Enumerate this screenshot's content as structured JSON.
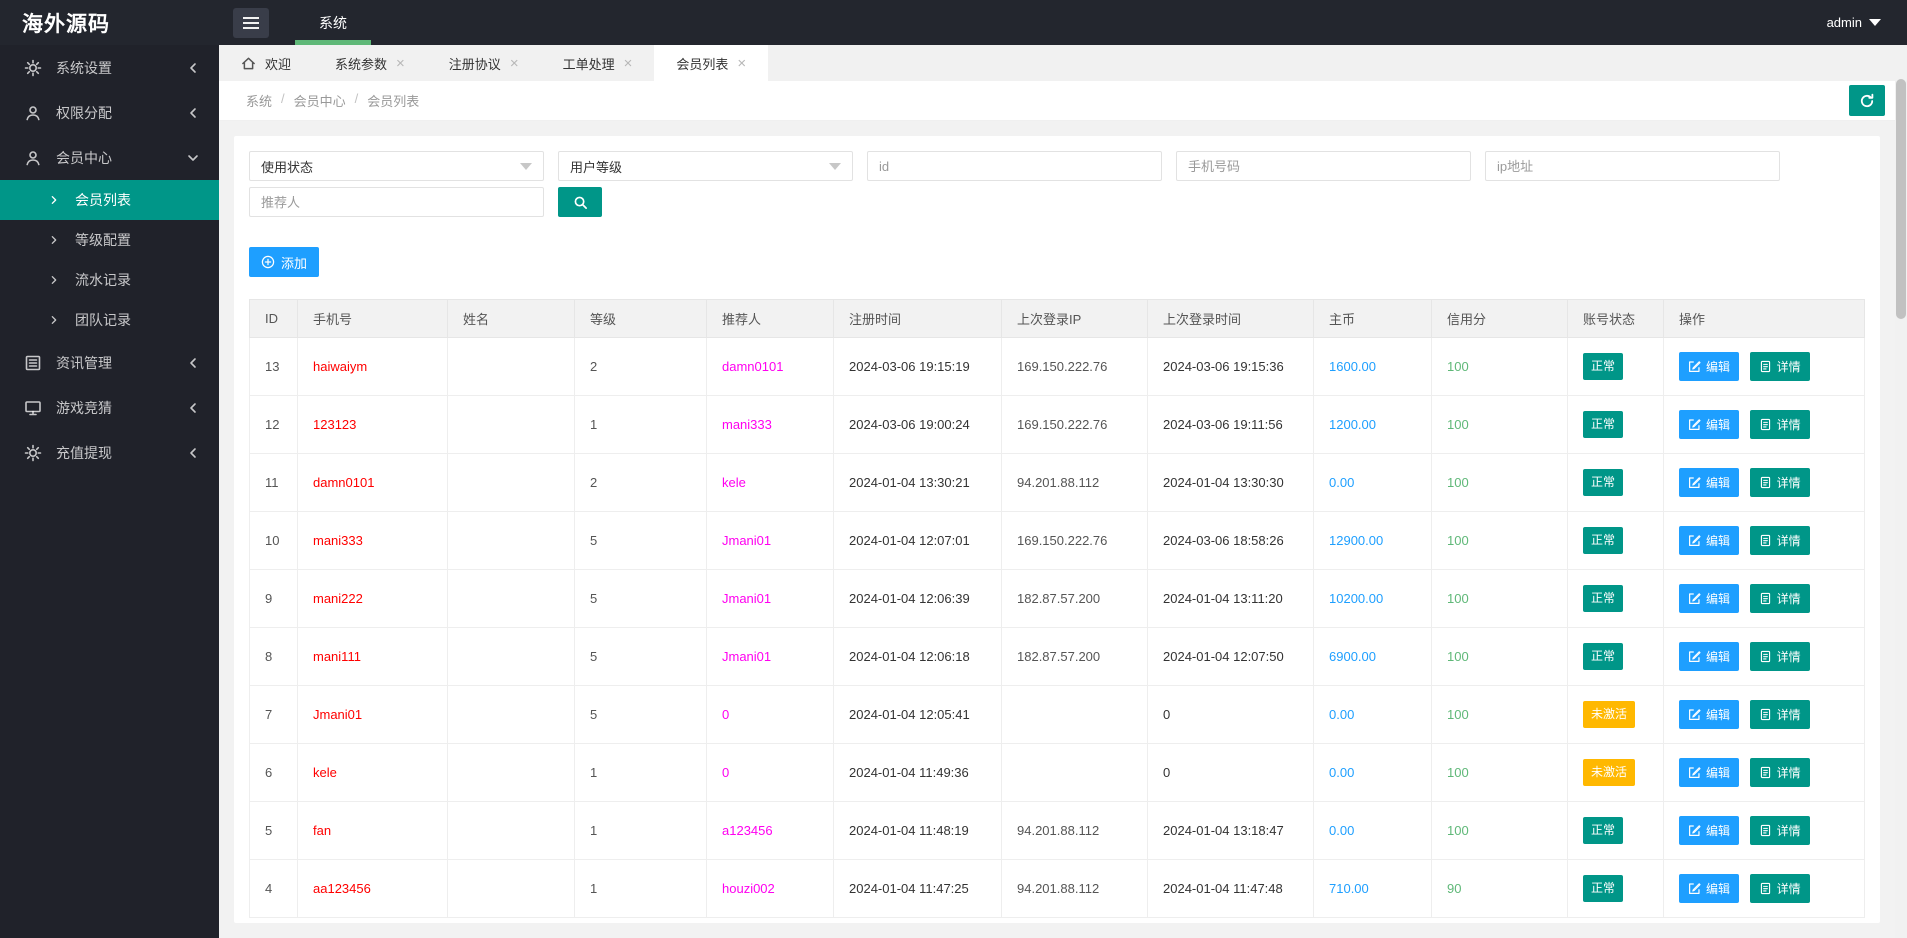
{
  "brand": {
    "logo_text": "海外源码"
  },
  "header": {
    "nav_system_label": "系统",
    "user_name": "admin"
  },
  "tabs": [
    {
      "label": "欢迎",
      "icon": "home-icon",
      "closable": false,
      "active": false
    },
    {
      "label": "系统参数",
      "closable": true,
      "active": false
    },
    {
      "label": "注册协议",
      "closable": true,
      "active": false
    },
    {
      "label": "工单处理",
      "closable": true,
      "active": false
    },
    {
      "label": "会员列表",
      "closable": true,
      "active": true
    }
  ],
  "close_glyph": "×",
  "breadcrumb": {
    "items": [
      "系统",
      "会员中心",
      "会员列表"
    ],
    "separator": "/"
  },
  "sidebar": {
    "items": [
      {
        "label": "系统设置",
        "icon": "gear-icon",
        "state": "collapsed"
      },
      {
        "label": "权限分配",
        "icon": "user-icon",
        "state": "collapsed"
      },
      {
        "label": "会员中心",
        "icon": "member-icon",
        "state": "expanded",
        "children": [
          {
            "label": "会员列表",
            "active": true
          },
          {
            "label": "等级配置",
            "active": false
          },
          {
            "label": "流水记录",
            "active": false
          },
          {
            "label": "团队记录",
            "active": false
          }
        ]
      },
      {
        "label": "资讯管理",
        "icon": "news-icon",
        "state": "collapsed"
      },
      {
        "label": "游戏竞猜",
        "icon": "monitor-icon",
        "state": "collapsed"
      },
      {
        "label": "充值提现",
        "icon": "gear-icon",
        "state": "collapsed"
      }
    ]
  },
  "filters": {
    "status_select_placeholder": "使用状态",
    "level_select_placeholder": "用户等级",
    "id_placeholder": "id",
    "phone_placeholder": "手机号码",
    "ip_placeholder": "ip地址",
    "referrer_placeholder": "推荐人"
  },
  "toolbar": {
    "add_label": "添加"
  },
  "table": {
    "columns": [
      "ID",
      "手机号",
      "姓名",
      "等级",
      "推荐人",
      "注册时间",
      "上次登录IP",
      "上次登录时间",
      "主币",
      "信用分",
      "账号状态",
      "操作"
    ],
    "status_labels": {
      "normal": "正常",
      "inactive": "未激活"
    },
    "actions": {
      "edit": "编辑",
      "detail": "详情"
    },
    "rows": [
      {
        "id": "13",
        "phone": "haiwaiym",
        "name": "",
        "level": "2",
        "referrer": "damn0101",
        "reg_time": "2024-03-06 19:15:19",
        "last_ip": "169.150.222.76",
        "last_time": "2024-03-06 19:15:36",
        "coin": "1600.00",
        "credit": "100",
        "status": "normal"
      },
      {
        "id": "12",
        "phone": "123123",
        "name": "",
        "level": "1",
        "referrer": "mani333",
        "reg_time": "2024-03-06 19:00:24",
        "last_ip": "169.150.222.76",
        "last_time": "2024-03-06 19:11:56",
        "coin": "1200.00",
        "credit": "100",
        "status": "normal"
      },
      {
        "id": "11",
        "phone": "damn0101",
        "name": "",
        "level": "2",
        "referrer": "kele",
        "reg_time": "2024-01-04 13:30:21",
        "last_ip": "94.201.88.112",
        "last_time": "2024-01-04 13:30:30",
        "coin": "0.00",
        "credit": "100",
        "status": "normal"
      },
      {
        "id": "10",
        "phone": "mani333",
        "name": "",
        "level": "5",
        "referrer": "Jmani01",
        "reg_time": "2024-01-04 12:07:01",
        "last_ip": "169.150.222.76",
        "last_time": "2024-03-06 18:58:26",
        "coin": "12900.00",
        "credit": "100",
        "status": "normal"
      },
      {
        "id": "9",
        "phone": "mani222",
        "name": "",
        "level": "5",
        "referrer": "Jmani01",
        "reg_time": "2024-01-04 12:06:39",
        "last_ip": "182.87.57.200",
        "last_time": "2024-01-04 13:11:20",
        "coin": "10200.00",
        "credit": "100",
        "status": "normal"
      },
      {
        "id": "8",
        "phone": "mani111",
        "name": "",
        "level": "5",
        "referrer": "Jmani01",
        "reg_time": "2024-01-04 12:06:18",
        "last_ip": "182.87.57.200",
        "last_time": "2024-01-04 12:07:50",
        "coin": "6900.00",
        "credit": "100",
        "status": "normal"
      },
      {
        "id": "7",
        "phone": "Jmani01",
        "name": "",
        "level": "5",
        "referrer": "0",
        "reg_time": "2024-01-04 12:05:41",
        "last_ip": "",
        "last_time": "0",
        "coin": "0.00",
        "credit": "100",
        "status": "inactive"
      },
      {
        "id": "6",
        "phone": "kele",
        "name": "",
        "level": "1",
        "referrer": "0",
        "reg_time": "2024-01-04 11:49:36",
        "last_ip": "",
        "last_time": "0",
        "coin": "0.00",
        "credit": "100",
        "status": "inactive"
      },
      {
        "id": "5",
        "phone": "fan",
        "name": "",
        "level": "1",
        "referrer": "a123456",
        "reg_time": "2024-01-04 11:48:19",
        "last_ip": "94.201.88.112",
        "last_time": "2024-01-04 13:18:47",
        "coin": "0.00",
        "credit": "100",
        "status": "normal"
      },
      {
        "id": "4",
        "phone": "aa123456",
        "name": "",
        "level": "1",
        "referrer": "houzi002",
        "reg_time": "2024-01-04 11:47:25",
        "last_ip": "94.201.88.112",
        "last_time": "2024-01-04 11:47:48",
        "coin": "710.00",
        "credit": "90",
        "status": "normal"
      }
    ]
  },
  "colors": {
    "header_bg": "#23262e",
    "sidebar_bg": "#20222a",
    "accent_teal": "#009688",
    "accent_green": "#5fb878",
    "accent_blue": "#1e9fff",
    "accent_orange": "#ffb800",
    "phone_red": "#ff0000",
    "referrer_magenta": "#ff00f0"
  },
  "icons": {
    "hamburger-icon": "three bars",
    "home-icon": "house outline",
    "refresh-icon": "circular arrow",
    "search-icon": "magnifier",
    "plus-icon": "circled plus",
    "edit-icon": "pencil on square",
    "detail-icon": "document"
  }
}
